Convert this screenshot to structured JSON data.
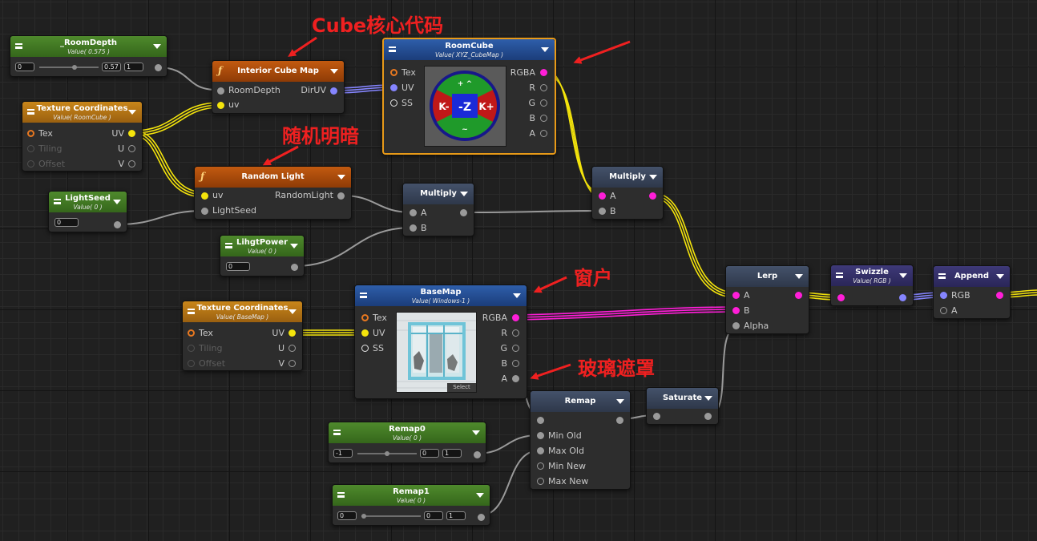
{
  "annotations": {
    "cube_core": "Cube核心代码",
    "random_light": "随机明暗",
    "window": "窗户",
    "glass_mask": "玻璃遮罩"
  },
  "colors": {
    "wire_yellow": "#f4e40c",
    "wire_magenta": "#ff1ed8",
    "wire_blue": "#8585ff",
    "selection": "#e89a18",
    "annotation": "#ef2020"
  },
  "nodes": {
    "room_depth": {
      "title": "_RoomDepth",
      "subtitle": "Value( 0.575 )",
      "min": "0",
      "value": "0.57",
      "max": "1",
      "slider_fraction": 0.575
    },
    "tex_coords_room": {
      "title": "Texture Coordinates",
      "subtitle": "Value( RoomCube )",
      "in_tex": "Tex",
      "in_tiling": "Tiling",
      "in_offset": "Offset",
      "out_uv": "UV",
      "out_u": "U",
      "out_v": "V"
    },
    "interior_cube_map": {
      "title": "Interior Cube Map",
      "in_room_depth": "RoomDepth",
      "in_uv": "uv",
      "out_dir_uv": "DirUV"
    },
    "room_cube": {
      "title": "RoomCube",
      "subtitle": "Value( XYZ_CubeMap )",
      "in_tex": "Tex",
      "in_uv": "UV",
      "in_ss": "SS",
      "out_rgba": "RGBA",
      "out_r": "R",
      "out_g": "G",
      "out_b": "B",
      "out_a": "A",
      "preview_label": "-Z"
    },
    "random_light": {
      "title": "Random Light",
      "in_uv": "uv",
      "in_light_seed": "LightSeed",
      "out_random_light": "RandomLight"
    },
    "light_seed": {
      "title": "LightSeed",
      "subtitle": "Value( 0 )",
      "value": "0"
    },
    "multiply_1": {
      "title": "Multiply",
      "in_a": "A",
      "in_b": "B"
    },
    "lihgt_power": {
      "title": "LihgtPower",
      "subtitle": "Value( 0 )",
      "value": "0"
    },
    "multiply_2": {
      "title": "Multiply",
      "in_a": "A",
      "in_b": "B"
    },
    "tex_coords_base": {
      "title": "Texture Coordinates",
      "subtitle": "Value( BaseMap )",
      "in_tex": "Tex",
      "in_tiling": "Tiling",
      "in_offset": "Offset",
      "out_uv": "UV",
      "out_u": "U",
      "out_v": "V"
    },
    "base_map": {
      "title": "BaseMap",
      "subtitle": "Value( Windows-1 )",
      "in_tex": "Tex",
      "in_uv": "UV",
      "in_ss": "SS",
      "out_rgba": "RGBA",
      "out_r": "R",
      "out_g": "G",
      "out_b": "B",
      "out_a": "A",
      "select_label": "Select"
    },
    "lerp": {
      "title": "Lerp",
      "in_a": "A",
      "in_b": "B",
      "in_alpha": "Alpha"
    },
    "swizzle": {
      "title": "Swizzle",
      "subtitle": "Value( RGB )"
    },
    "append": {
      "title": "Append",
      "in_rgb": "RGB",
      "in_a": "A"
    },
    "saturate": {
      "title": "Saturate"
    },
    "remap": {
      "title": "Remap",
      "in_min_old": "Min Old",
      "in_max_old": "Max Old",
      "in_min_new": "Min New",
      "in_max_new": "Max New"
    },
    "remap0": {
      "title": "Remap0",
      "subtitle": "Value( 0 )",
      "min": "-1",
      "value": "0",
      "max": "1",
      "slider_fraction": 0.5
    },
    "remap1": {
      "title": "Remap1",
      "subtitle": "Value( 0 )",
      "min": "0",
      "value": "0",
      "max": "1",
      "slider_fraction": 0.0
    }
  }
}
